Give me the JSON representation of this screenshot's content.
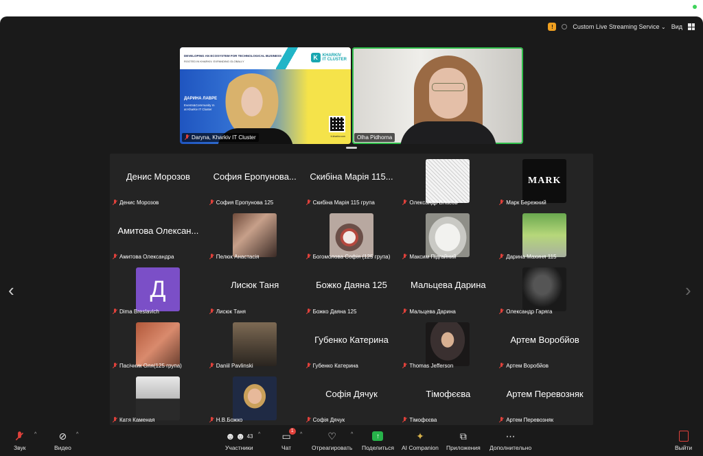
{
  "topbar": {
    "streaming_label": "Custom Live Streaming Service",
    "view_label": "Вид"
  },
  "speakers": [
    {
      "name": "Daryna, Kharkiv IT Cluster",
      "slide": {
        "headline": "DEVELOPING AN ECOSYSTEM FOR TECHNOLOGICAL BUSINESS",
        "subline": "ROOTED IN KHARKIV. EXPANDING GLOBALLY",
        "logo_line1": "KHARKIV",
        "logo_line2": "IT CLUSTER",
        "presenter": "ДАРИНА ЛАВРЕ",
        "role_line1": "Events&Community m",
        "role_line2": "at Kharkiv IT Cluster",
        "url": "it-kharkiv.com"
      }
    },
    {
      "name": "Olha Pidhorna"
    }
  ],
  "gallery": [
    {
      "display": "Денис Морозов",
      "label": "Денис Морозов",
      "type": "name"
    },
    {
      "display": "София Еропунова...",
      "label": "София Еропунова 125",
      "type": "name"
    },
    {
      "display": "Скибіна Марія 115...",
      "label": "Скибіна Марія 115 група",
      "type": "name"
    },
    {
      "display": "",
      "label": "Олександр Власов",
      "type": "sketch"
    },
    {
      "display": "MARK",
      "label": "Марк Бережний",
      "type": "mark"
    },
    {
      "display": "Амитова Олексан...",
      "label": "Амитова Олександра",
      "type": "name"
    },
    {
      "display": "",
      "label": "Пелюк Анастасія",
      "type": "photo-collage"
    },
    {
      "display": "",
      "label": "Богомолова Софія (125 група)",
      "type": "photo-cake"
    },
    {
      "display": "",
      "label": "Максим Підгайний",
      "type": "photo-cat"
    },
    {
      "display": "",
      "label": "Дарина Махиня 115",
      "type": "photo-tree"
    },
    {
      "display": "Д",
      "label": "Dima Breslavich",
      "type": "letter"
    },
    {
      "display": "Лисюк Таня",
      "label": "Лисюк Таня",
      "type": "name"
    },
    {
      "display": "Божко Даяна 125",
      "label": "Божко Даяна 125",
      "type": "name"
    },
    {
      "display": "Мальцева Дарина",
      "label": "Мальцева Дарина",
      "type": "name"
    },
    {
      "display": "",
      "label": "Олександр Гаряга",
      "type": "photo-dark"
    },
    {
      "display": "",
      "label": "Пасічник Оля(125 група)",
      "type": "photo-redhair"
    },
    {
      "display": "",
      "label": "Daniil Pavlinski",
      "type": "photo-man"
    },
    {
      "display": "Губенко Катерина",
      "label": "Губенко Катерина",
      "type": "name"
    },
    {
      "display": "",
      "label": "Thomas Jefferson",
      "type": "photo-portrait"
    },
    {
      "display": "Артем Воробйов",
      "label": "Артем Воробйов",
      "type": "name"
    },
    {
      "display": "",
      "label": "Катя Каменая",
      "type": "photo-mirror"
    },
    {
      "display": "",
      "label": "Н.В.Божко",
      "type": "photo-woman"
    },
    {
      "display": "Софія Дячук",
      "label": "Софія Дячук",
      "type": "name"
    },
    {
      "display": "Тімофєєва",
      "label": "Тімофєєва",
      "type": "name"
    },
    {
      "display": "Артем Перевозняк",
      "label": "Артем Перевозняк",
      "type": "name"
    }
  ],
  "toolbar": {
    "audio": "Звук",
    "video": "Видео",
    "participants": "Участники",
    "participants_count": "43",
    "chat": "Чат",
    "chat_badge": "1",
    "react": "Отреагировать",
    "share": "Поделиться",
    "ai": "AI Companion",
    "apps": "Приложения",
    "more": "Дополнительно",
    "leave": "Выйти"
  },
  "colors": {
    "window_bg": "#1a1a1a",
    "gallery_bg": "#242424",
    "active_speaker": "#2fbf4a",
    "muted": "#e0413b",
    "share": "#27b34a",
    "letter_avatar": "#7b4fc7"
  }
}
